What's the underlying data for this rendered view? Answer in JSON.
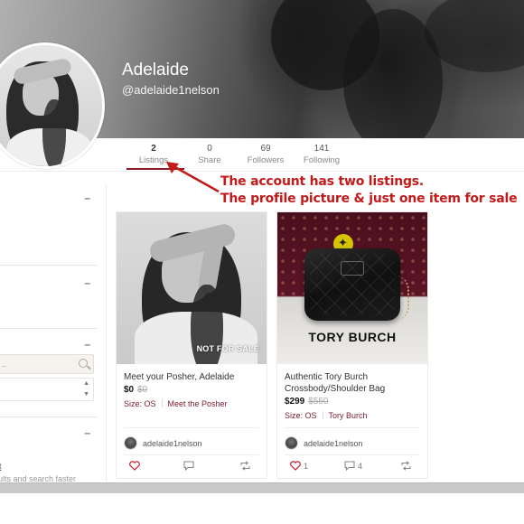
{
  "profile": {
    "name": "Adelaide",
    "handle": "@adelaide1nelson"
  },
  "stats": [
    {
      "num": "2",
      "label": "Listings",
      "active": true
    },
    {
      "num": "0",
      "label": "Share"
    },
    {
      "num": "69",
      "label": "Followers"
    },
    {
      "num": "141",
      "label": "Following"
    }
  ],
  "annotation": {
    "line1": "The account has two listings.",
    "line2": "The profile picture & just one item for sale",
    "color": "#c41a1a"
  },
  "sidebar": {
    "collapse_symbol": "–",
    "search_placeholder": "..",
    "link_text": "t",
    "hint_text": "ults and search faster"
  },
  "listings": [
    {
      "title": "Meet your Posher, Adelaide",
      "price": "$0",
      "original_price": "$0",
      "size": "Size: OS",
      "brand": "Meet the Posher",
      "badge": "NOT FOR SALE",
      "seller": "adelaide1nelson",
      "likes": "",
      "comments": ""
    },
    {
      "title": "Authentic Tory Burch Crossbody/Shoulder Bag",
      "price": "$299",
      "original_price": "$550",
      "size": "Size: OS",
      "brand": "Tory Burch",
      "image_text": "TORY BURCH",
      "seller": "adelaide1nelson",
      "likes": "1",
      "comments": "4"
    }
  ],
  "colors": {
    "accent": "#8b1a26",
    "annotation": "#c41a1a"
  }
}
